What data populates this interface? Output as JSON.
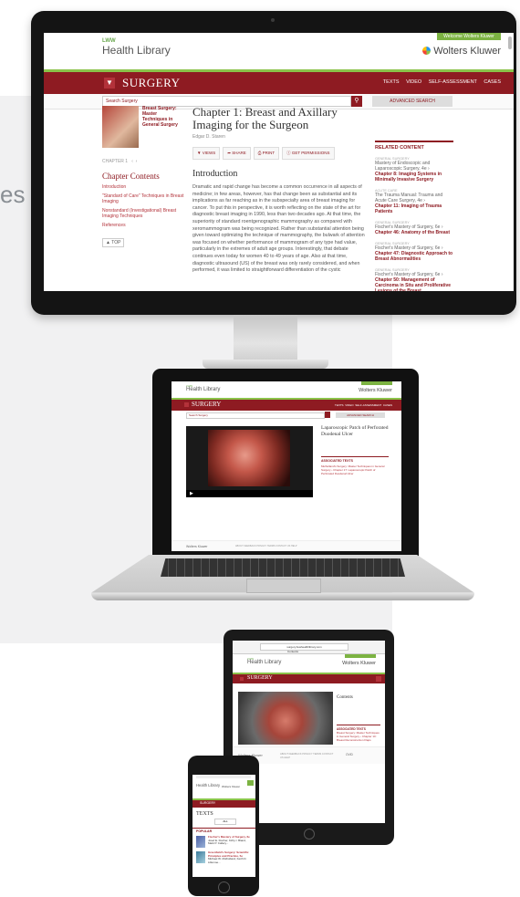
{
  "edge_text": "es",
  "site": {
    "lww": "LWW",
    "health_library": "Health Library",
    "wolters_kluwer": "Wolters Kluwer",
    "login": "Welcome Wolters Kluwer",
    "section": "SURGERY",
    "nav": [
      "TEXTS",
      "VIDEO",
      "SELF-ASSESSMENT",
      "CASES"
    ],
    "search_placeholder": "Search Surgery",
    "advanced_search": "ADVANCED SEARCH"
  },
  "monitor": {
    "book_title": "Breast Surgery: Master Techniques in General Surgery",
    "chapter_nav": "CHAPTER 1",
    "chapter_contents": "Chapter Contents",
    "contents": [
      "Introduction",
      "\"Standard of Care\" Techniques in Breast Imaging",
      "Nonstandard (Investigational) Breast Imaging Techniques",
      "References"
    ],
    "top_button": "▲ TOP",
    "chapter_title": "Chapter 1: Breast and Axillary Imaging for the Surgeon",
    "author": "Edgar D. Staren",
    "tools": [
      "▼ VIEWS",
      "➦ SHARE",
      "⎙ PRINT",
      "ⓘ GET PERMISSIONS"
    ],
    "intro_heading": "Introduction",
    "body_text": "Dramatic and rapid change has become a common occurrence in all aspects of medicine; in few areas, however, has that change been as substantial and its implications as far reaching as in the subspecialty area of breast imaging for cancer. To put this in perspective, it is worth reflecting on the state of the art for diagnostic breast imaging in 1990, less than two decades ago. At that time, the superiority of standard roentgenographic mammography as compared with xeromammogram was being recognized. Rather than substantial attention being given toward optimizing the technique of mammography, the bulwark of attention was focused on whether performance of mammogram of any type had value, particularly in the extremes of adult age groups. Interestingly, that debate continues even today for women 40 to 49 years of age. Also at that time, diagnostic ultrasound (US) of the breast was only rarely considered, and when performed, it was limited to straightforward differentiation of the cystic",
    "related_heading": "RELATED CONTENT",
    "related": [
      {
        "cat": "GENERAL SURGERY",
        "book": "Mastery of Endoscopic and Laparoscopic Surgery, 4e ›",
        "chapter": "Chapter 8: Imaging Systems in Minimally Invasive Surgery"
      },
      {
        "cat": "ACUTE CARE",
        "book": "The Trauma Manual: Trauma and Acute Care Surgery, 4e ›",
        "chapter": "Chapter 11: Imaging of Trauma Patients"
      },
      {
        "cat": "GENERAL SURGERY",
        "book": "Fischer's Mastery of Surgery, 6e ›",
        "chapter": "Chapter 46: Anatomy of the Breast"
      },
      {
        "cat": "GENERAL SURGERY",
        "book": "Fischer's Mastery of Surgery, 6e ›",
        "chapter": "Chapter 47: Diagnostic Approach to Breast Abnormalities"
      },
      {
        "cat": "GENERAL SURGERY",
        "book": "Fischer's Mastery of Surgery, 6e ›",
        "chapter": "Chapter 50: Management of Carcinoma in Situ and Proliferative Lesions of the Breast"
      }
    ]
  },
  "laptop": {
    "video_title": "Laparoscopic Patch of Perforated Duodenal Ulcer",
    "related_heading": "ASSOCIATED TEXTS",
    "related_text": "Mulholland's Surgery: Master Techniques in General Surgery › Chapter 17: Laparoscopic Patch of Perforated Duodenal Ulcer",
    "footer_wk": "Wolters Kluwer",
    "footer_links": "ABOUT   FEEDBACK   PRIVACY   TERMS   CONTACT US   HELP"
  },
  "tablet": {
    "url": "surgery.lwwhealthlibrary.com",
    "tab_title": "Contents",
    "contents_label": "Contents",
    "related_heading": "ASSOCIATED TEXTS",
    "related_text": "Breast Surgery: Master Techniques in General Surgery › Chapter 10: Breast Reconstruction Flaps",
    "footer_wk": "Wolters Kluwer",
    "footer_links": "ABOUT   FEEDBACK   PRIVACY   TERMS   CONTACT US   HELP",
    "footer_wk2": "OVID"
  },
  "phone": {
    "texts_heading": "TEXTS",
    "select_value": "ALL",
    "popular": "POPULAR",
    "items": [
      {
        "title": "Fischer's Mastery of Surgery, 6e",
        "desc": "Josef E. Fischer, Kirby I. Bland, Mark P. Callery..."
      },
      {
        "title": "Greenfield's Surgery: Scientific Principles and Practice, 5e",
        "desc": "Michael W. Mulholland, Keith D. Lillemoe..."
      }
    ]
  }
}
